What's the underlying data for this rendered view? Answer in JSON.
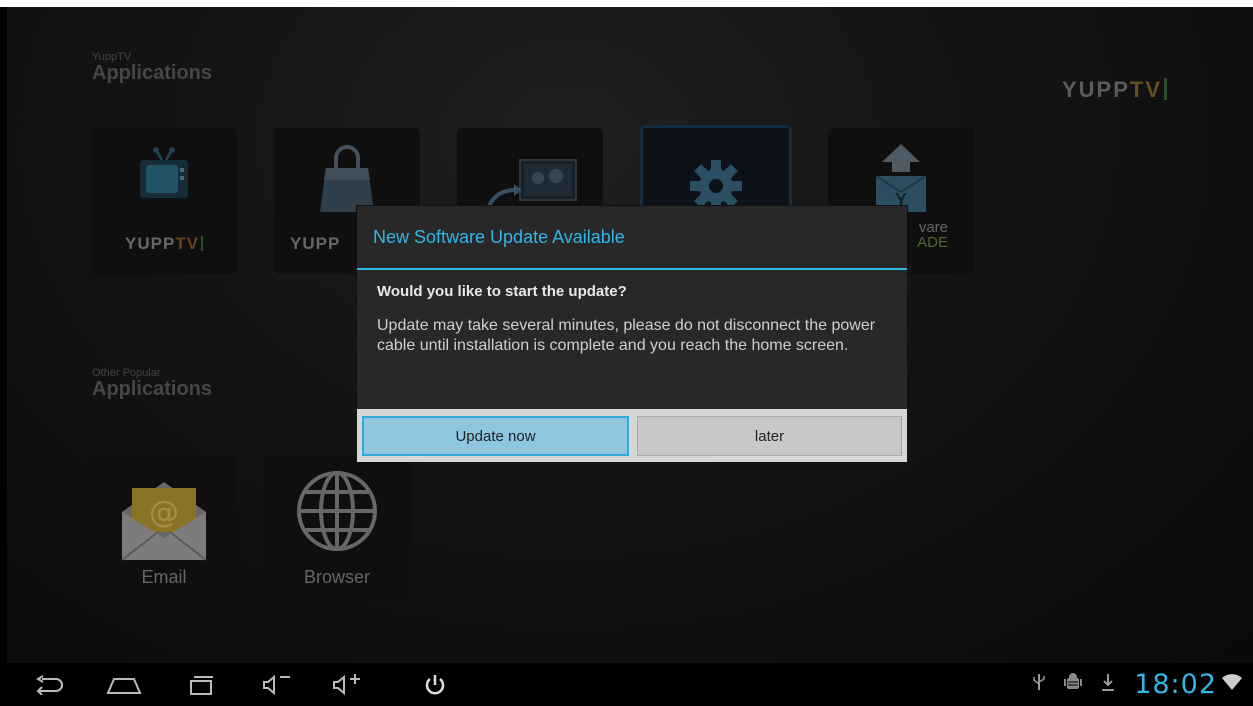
{
  "sections": {
    "yupptv": {
      "small": "YuppTV",
      "big": "Applications"
    },
    "other": {
      "small": "Other Popular",
      "big": "Applications"
    }
  },
  "brand": {
    "yupp": "YUPP",
    "tv": "TV"
  },
  "tiles": {
    "yupptv": {
      "yupp": "YUPP",
      "tv": "TV"
    },
    "yuppstore": {
      "yupp": "YUPP"
    },
    "upgrade": {
      "line1": "vare",
      "line2": "ADE"
    },
    "email": {
      "label": "Email"
    },
    "browser": {
      "label": "Browser"
    }
  },
  "dialog": {
    "title": "New Software Update Available",
    "question": "Would you like to start the update?",
    "message": "Update may take several minutes, please do not disconnect the power cable until installation is complete and you reach the home screen.",
    "update_now": "Update now",
    "later": "later"
  },
  "status": {
    "time": "18:02"
  },
  "colors": {
    "accent": "#33b5e5",
    "dialog_bg": "#282828",
    "button_primary": "#8ec6e0"
  },
  "icons": [
    "back-icon",
    "home-icon",
    "recent-apps-icon",
    "volume-down-icon",
    "volume-up-icon",
    "power-icon",
    "usb-icon",
    "android-debug-icon",
    "download-icon",
    "wifi-icon"
  ]
}
